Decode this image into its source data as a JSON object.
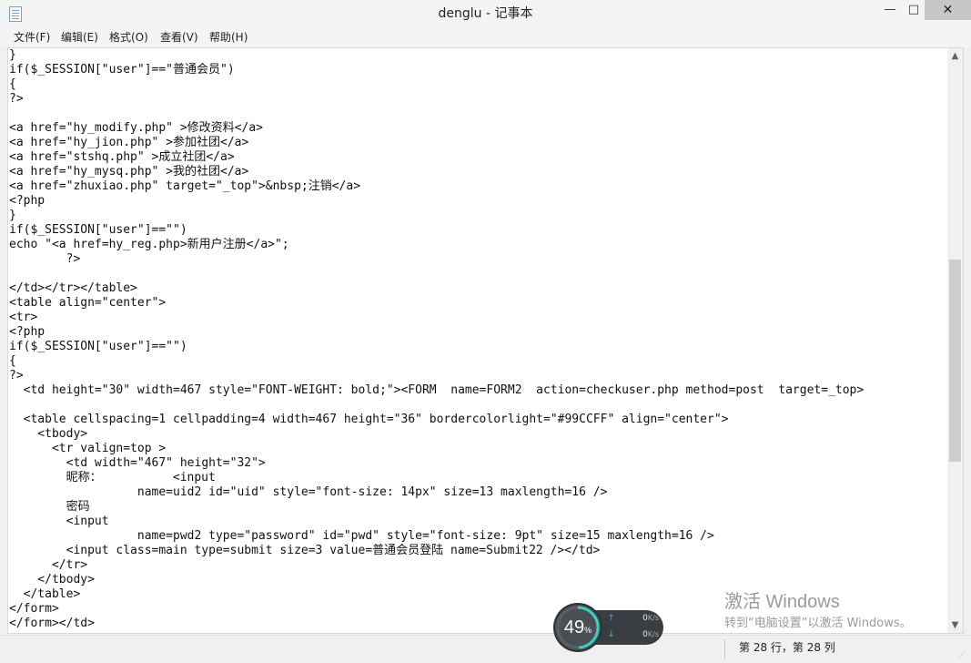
{
  "window": {
    "title": "denglu - 记事本"
  },
  "titlebar": {
    "minimize": "—",
    "maximize": "□",
    "close": "✕"
  },
  "menu": [
    "文件(F)",
    "编辑(E)",
    "格式(O)",
    "查看(V)",
    "帮助(H)"
  ],
  "editor": {
    "lines": [
      "}",
      "if($_SESSION[\"user\"]==\"普通会员\")",
      "{",
      "?>",
      "",
      "<a href=\"hy_modify.php\" >修改资料</a>",
      "<a href=\"hy_jion.php\" >参加社团</a>",
      "<a href=\"stshq.php\" >成立社团</a>",
      "<a href=\"hy_mysq.php\" >我的社团</a>",
      "<a href=\"zhuxiao.php\" target=\"_top\">&nbsp;注销</a>",
      "<?php",
      "}",
      "if($_SESSION[\"user\"]==\"\")",
      "echo \"<a href=hy_reg.php>新用户注册</a>\";",
      "        ?>",
      "",
      "</td></tr></table>",
      "<table align=\"center\">",
      "<tr>",
      "<?php",
      "if($_SESSION[\"user\"]==\"\")",
      "{",
      "?>",
      "  <td height=\"30\" width=467 style=\"FONT-WEIGHT: bold;\"><FORM  name=FORM2  action=checkuser.php method=post  target=_top>",
      "",
      "  <table cellspacing=1 cellpadding=4 width=467 height=\"36\" bordercolorlight=\"#99CCFF\" align=\"center\">",
      "    <tbody>",
      "      <tr valign=top >",
      "        <td width=\"467\" height=\"32\">",
      "        昵称：          <input",
      "                  name=uid2 id=\"uid\" style=\"font-size: 14px\" size=13 maxlength=16 />",
      "        密码",
      "        <input",
      "                  name=pwd2 type=\"password\" id=\"pwd\" style=\"font-size: 9pt\" size=15 maxlength=16 />",
      "        <input class=main type=submit size=3 value=普通会员登陆 name=Submit22 /></td>",
      "      </tr>",
      "    </tbody>",
      "  </table>",
      "</form>",
      "</form></td>"
    ]
  },
  "scrollbar": {
    "up": "▲",
    "down": "▼"
  },
  "status": {
    "position": "第 28 行，第 28 列",
    "grip": "⋰"
  },
  "watermark": {
    "line1": "激活 Windows",
    "line2": "转到“电脑设置”以激活 Windows。"
  },
  "net_monitor": {
    "percent": 49,
    "percent_text": "49",
    "percent_sign": "%",
    "up_rate": "0",
    "down_rate": "0",
    "unit": "K/s",
    "up_arrow": "↑",
    "down_arrow": "↓"
  }
}
